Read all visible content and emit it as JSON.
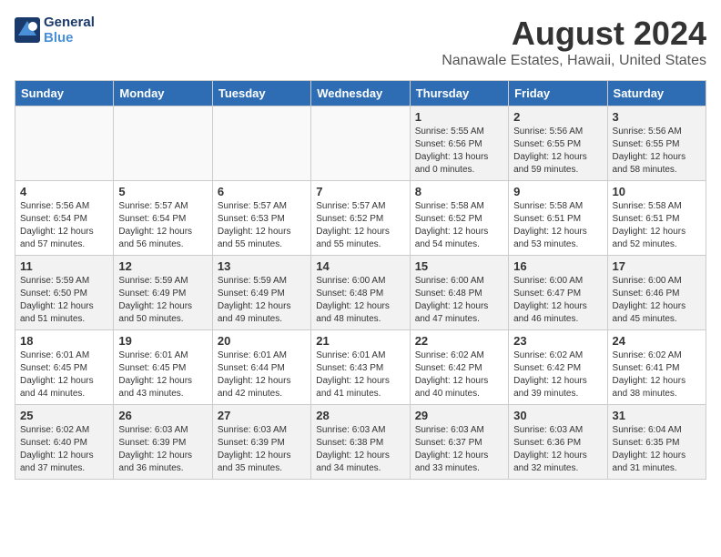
{
  "header": {
    "logo_line1": "General",
    "logo_line2": "Blue",
    "title": "August 2024",
    "subtitle": "Nanawale Estates, Hawaii, United States"
  },
  "weekdays": [
    "Sunday",
    "Monday",
    "Tuesday",
    "Wednesday",
    "Thursday",
    "Friday",
    "Saturday"
  ],
  "weeks": [
    [
      {
        "day": "",
        "info": ""
      },
      {
        "day": "",
        "info": ""
      },
      {
        "day": "",
        "info": ""
      },
      {
        "day": "",
        "info": ""
      },
      {
        "day": "1",
        "info": "Sunrise: 5:55 AM\nSunset: 6:56 PM\nDaylight: 13 hours\nand 0 minutes."
      },
      {
        "day": "2",
        "info": "Sunrise: 5:56 AM\nSunset: 6:55 PM\nDaylight: 12 hours\nand 59 minutes."
      },
      {
        "day": "3",
        "info": "Sunrise: 5:56 AM\nSunset: 6:55 PM\nDaylight: 12 hours\nand 58 minutes."
      }
    ],
    [
      {
        "day": "4",
        "info": "Sunrise: 5:56 AM\nSunset: 6:54 PM\nDaylight: 12 hours\nand 57 minutes."
      },
      {
        "day": "5",
        "info": "Sunrise: 5:57 AM\nSunset: 6:54 PM\nDaylight: 12 hours\nand 56 minutes."
      },
      {
        "day": "6",
        "info": "Sunrise: 5:57 AM\nSunset: 6:53 PM\nDaylight: 12 hours\nand 55 minutes."
      },
      {
        "day": "7",
        "info": "Sunrise: 5:57 AM\nSunset: 6:52 PM\nDaylight: 12 hours\nand 55 minutes."
      },
      {
        "day": "8",
        "info": "Sunrise: 5:58 AM\nSunset: 6:52 PM\nDaylight: 12 hours\nand 54 minutes."
      },
      {
        "day": "9",
        "info": "Sunrise: 5:58 AM\nSunset: 6:51 PM\nDaylight: 12 hours\nand 53 minutes."
      },
      {
        "day": "10",
        "info": "Sunrise: 5:58 AM\nSunset: 6:51 PM\nDaylight: 12 hours\nand 52 minutes."
      }
    ],
    [
      {
        "day": "11",
        "info": "Sunrise: 5:59 AM\nSunset: 6:50 PM\nDaylight: 12 hours\nand 51 minutes."
      },
      {
        "day": "12",
        "info": "Sunrise: 5:59 AM\nSunset: 6:49 PM\nDaylight: 12 hours\nand 50 minutes."
      },
      {
        "day": "13",
        "info": "Sunrise: 5:59 AM\nSunset: 6:49 PM\nDaylight: 12 hours\nand 49 minutes."
      },
      {
        "day": "14",
        "info": "Sunrise: 6:00 AM\nSunset: 6:48 PM\nDaylight: 12 hours\nand 48 minutes."
      },
      {
        "day": "15",
        "info": "Sunrise: 6:00 AM\nSunset: 6:48 PM\nDaylight: 12 hours\nand 47 minutes."
      },
      {
        "day": "16",
        "info": "Sunrise: 6:00 AM\nSunset: 6:47 PM\nDaylight: 12 hours\nand 46 minutes."
      },
      {
        "day": "17",
        "info": "Sunrise: 6:00 AM\nSunset: 6:46 PM\nDaylight: 12 hours\nand 45 minutes."
      }
    ],
    [
      {
        "day": "18",
        "info": "Sunrise: 6:01 AM\nSunset: 6:45 PM\nDaylight: 12 hours\nand 44 minutes."
      },
      {
        "day": "19",
        "info": "Sunrise: 6:01 AM\nSunset: 6:45 PM\nDaylight: 12 hours\nand 43 minutes."
      },
      {
        "day": "20",
        "info": "Sunrise: 6:01 AM\nSunset: 6:44 PM\nDaylight: 12 hours\nand 42 minutes."
      },
      {
        "day": "21",
        "info": "Sunrise: 6:01 AM\nSunset: 6:43 PM\nDaylight: 12 hours\nand 41 minutes."
      },
      {
        "day": "22",
        "info": "Sunrise: 6:02 AM\nSunset: 6:42 PM\nDaylight: 12 hours\nand 40 minutes."
      },
      {
        "day": "23",
        "info": "Sunrise: 6:02 AM\nSunset: 6:42 PM\nDaylight: 12 hours\nand 39 minutes."
      },
      {
        "day": "24",
        "info": "Sunrise: 6:02 AM\nSunset: 6:41 PM\nDaylight: 12 hours\nand 38 minutes."
      }
    ],
    [
      {
        "day": "25",
        "info": "Sunrise: 6:02 AM\nSunset: 6:40 PM\nDaylight: 12 hours\nand 37 minutes."
      },
      {
        "day": "26",
        "info": "Sunrise: 6:03 AM\nSunset: 6:39 PM\nDaylight: 12 hours\nand 36 minutes."
      },
      {
        "day": "27",
        "info": "Sunrise: 6:03 AM\nSunset: 6:39 PM\nDaylight: 12 hours\nand 35 minutes."
      },
      {
        "day": "28",
        "info": "Sunrise: 6:03 AM\nSunset: 6:38 PM\nDaylight: 12 hours\nand 34 minutes."
      },
      {
        "day": "29",
        "info": "Sunrise: 6:03 AM\nSunset: 6:37 PM\nDaylight: 12 hours\nand 33 minutes."
      },
      {
        "day": "30",
        "info": "Sunrise: 6:03 AM\nSunset: 6:36 PM\nDaylight: 12 hours\nand 32 minutes."
      },
      {
        "day": "31",
        "info": "Sunrise: 6:04 AM\nSunset: 6:35 PM\nDaylight: 12 hours\nand 31 minutes."
      }
    ]
  ]
}
